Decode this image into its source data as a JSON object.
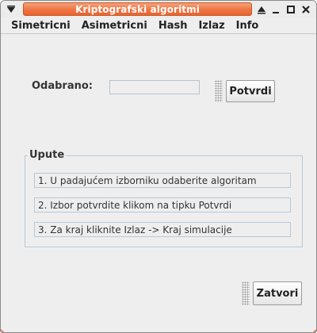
{
  "window": {
    "title": "Kriptografski algoritmi",
    "title_color": "#ee7443"
  },
  "titlebar_icons": [
    "menu-down-icon",
    "shade-up-icon",
    "minimize-icon",
    "maximize-icon",
    "close-icon"
  ],
  "menubar": {
    "items": [
      {
        "label": "Simetricni"
      },
      {
        "label": "Asimetricni"
      },
      {
        "label": "Hash"
      },
      {
        "label": "Izlaz"
      },
      {
        "label": "Info"
      }
    ]
  },
  "selection": {
    "label": "Odabrano:",
    "value": "",
    "confirm_label": "Potvrdi"
  },
  "instructions": {
    "title": "Upute",
    "steps": [
      "1. U padajućem izborniku odaberite algoritam",
      "2. Izbor potvrdite klikom na tipku Potvrdi",
      "3. Za kraj kliknite Izlaz -> Kraj simulacije"
    ]
  },
  "footer": {
    "close_label": "Zatvori"
  }
}
